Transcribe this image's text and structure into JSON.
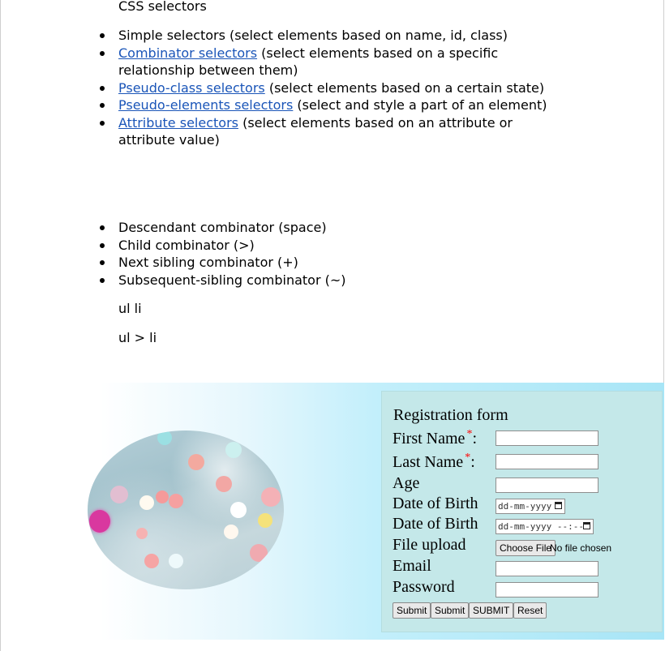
{
  "heading": "CSS selectors",
  "selector_list": [
    {
      "link": "",
      "text": "Simple selectors (select elements based on name, id, class)"
    },
    {
      "link": "Combinator selectors",
      "text": " (select elements based on a specific relationship between them)"
    },
    {
      "link": "Pseudo-class selectors",
      "text": " (select elements based on a certain state)"
    },
    {
      "link": "Pseudo-elements selectors",
      "text": " (select and style a part of an element)"
    },
    {
      "link": "Attribute selectors",
      "text": " (select elements based on an attribute or attribute value)"
    }
  ],
  "combinator_list": [
    "Descendant combinator (space)",
    "Child combinator (>)",
    "Next sibling combinator (+)",
    "Subsequent-sibling combinator (~)"
  ],
  "examples": [
    "ul li",
    "ul > li"
  ],
  "colors": {
    "link": "#1a55b8",
    "panel_background": "#c4e8e9",
    "required_star": "#ff0000"
  },
  "form": {
    "title": "Registration form",
    "first_name_label": "First Name",
    "last_name_label": "Last Name",
    "required_mark": "*",
    "colon": ":",
    "age_label": "Age",
    "dob_label": "Date of Birth",
    "dob_placeholder": "dd-mm-yyyy",
    "dob2_label": "Date of Birth",
    "dob2_placeholder": "dd-mm-yyyy --:--",
    "file_label": "File upload",
    "choose_file_label": "Choose File",
    "no_file_text": "No file chosen",
    "email_label": "Email",
    "password_label": "Password",
    "buttons": [
      "Submit",
      "Submit",
      "SUBMIT",
      "Reset"
    ]
  }
}
